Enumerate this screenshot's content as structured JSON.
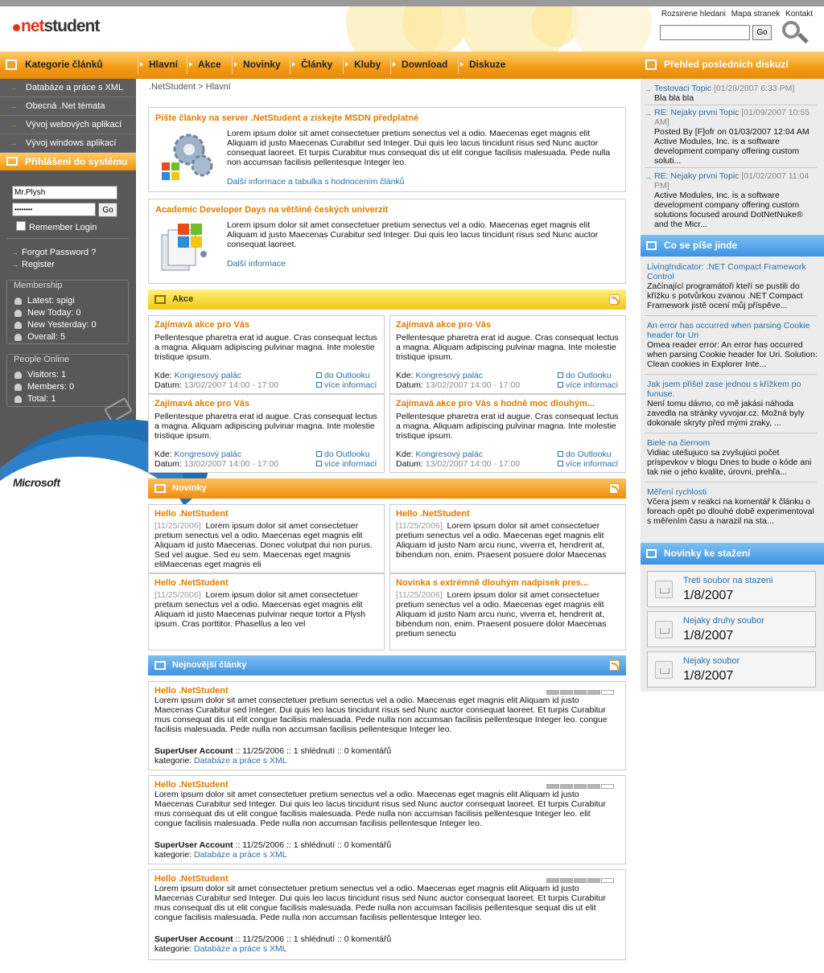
{
  "header": {
    "logo_dot": ".",
    "logo_net": "net",
    "logo_student": "student",
    "toplinks": [
      "Rozsirene hledani",
      "Mapa stranek",
      "Kontakt"
    ],
    "search_go": "Go"
  },
  "nav": {
    "categories_label": "Kategorie článků",
    "items": [
      "Hlavní",
      "Akce",
      "Novinky",
      "Články",
      "Kluby",
      "Download",
      "Diskuze"
    ],
    "right_label": "Přehled posledních diskuzí"
  },
  "sidebar": {
    "items": [
      "Databáze a práce s XML",
      "Obecná .Net témata",
      "Vývoj webových aplikací",
      "Vývoj windows aplikací"
    ],
    "login_title": "Přihlášeni do systému",
    "username": "Mr.Plysh",
    "password": "••••••••",
    "go": "Go",
    "remember": "Remember Login",
    "forgot": "Forgot Password ?",
    "register": "Register",
    "membership_title": "Membership",
    "membership": [
      "Latest: spigi",
      "New Today: 0",
      "New Yesterday: 0",
      "Overall: 5"
    ],
    "people_title": "People Online",
    "people": [
      "Visitors: 1",
      "Members: 0",
      "Total: 1"
    ],
    "microsoft": "Microsoft"
  },
  "breadcrumb": ".NetStudent > Hlavní",
  "features": [
    {
      "title": "Pište články na server .NetStudent a získejte MSDN předplatné",
      "body": "Lorem ipsum dolor sit amet consectetuer pretium senectus vel a odio. Maecenas eget magnis elit Aliquam id justo Maecenas Curabitur sed Integer. Dui quis leo lacus tincidunt risus sed Nunc auctor consequat laoreet. Et turpis Curabitur mus consequat dis ut elit congue facilisis malesuada. Pede nulla non accumsan facilisis pellentesque Integer leo.",
      "link": "Další informace a tabulka s hodnocením článků"
    },
    {
      "title": "Academic Developer Days na většině českých univerzit",
      "body": "Lorem ipsum dolor sit amet consectetuer pretium senectus vel a odio. Maecenas eget magnis elit Aliquam id justo Maecenas Curabitur sed Integer. Dui quis leo lacus tincidunt risus sed Nunc auctor consequat laoreet.",
      "link": "Další informace"
    }
  ],
  "akce": {
    "title": "Akce",
    "cards": [
      {
        "title": "Zajímavá akce pro Vás",
        "body": "Pellentesque pharetra erat id augue. Cras consequat lectus a magna. Aliquam adipiscing pulvinar magna. Inte molestie tristique ipsum.",
        "kde_label": "Kde:",
        "kde": "Kongresový palác",
        "datum_label": "Datum:",
        "datum": "13/02/2007 14:00 - 17:00",
        "outlook": "do Outlooku",
        "more": "více informací"
      },
      {
        "title": "Zajímavá akce pro Vás",
        "body": "Pellentesque pharetra erat id augue. Cras consequat lectus a magna. Aliquam adipiscing pulvinar magna. Inte molestie tristique ipsum.",
        "kde_label": "Kde:",
        "kde": "Kongresový palác",
        "datum_label": "Datum:",
        "datum": "13/02/2007 14:00 - 17:00",
        "outlook": "do Outlooku",
        "more": "více informací"
      },
      {
        "title": "Zajímavá akce pro Vás",
        "body": "Pellentesque pharetra erat id augue. Cras consequat lectus a magna. Aliquam adipiscing pulvinar magna. Inte molestie tristique ipsum.",
        "kde_label": "Kde:",
        "kde": "Kongresový palác",
        "datum_label": "Datum:",
        "datum": "13/02/2007 14:00 - 17:00",
        "outlook": "do Outlooku",
        "more": "více informací"
      },
      {
        "title": "Zajímavá akce pro Vás s hodně moc dlouhým...",
        "body": "Pellentesque pharetra erat id augue. Cras consequat lectus a magna. Aliquam adipiscing pulvinar magna. Inte molestie tristique ipsum.",
        "kde_label": "Kde:",
        "kde": "Kongresový palác",
        "datum_label": "Datum:",
        "datum": "13/02/2007 14:00 - 17:00",
        "outlook": "do Outlooku",
        "more": "více informací"
      }
    ]
  },
  "novinky": {
    "title": "Novinky",
    "cards": [
      {
        "title": "Hello .NetStudent",
        "date": "[11/25/2006]",
        "body": "Lorem ipsum dolor sit amet consectetuer pretium senectus vel a odio. Maecenas eget magnis elit Aliquam id justo Maecenas. Donec volutpat dui non purus. Sed vel augue. Sed eu sem. Maecenas eget magnis eliMaecenas eget magnis eli"
      },
      {
        "title": "Hello .NetStudent",
        "date": "[11/25/2006]",
        "body": "Lorem ipsum dolor sit amet consectetuer pretium senectus vel a odio. Maecenas eget magnis elit Aliquam id justo Nam arcu nunc, viverra et, hendrerit at, bibendum non, enim. Praesent posuere dolor Maecenas"
      },
      {
        "title": "Hello .NetStudent",
        "date": "[11/25/2006]",
        "body": "Lorem ipsum dolor sit amet consectetuer pretium senectus vel a odio. Maecenas eget magnis elit Aliquam id justo Maecenas pulvinar neque tortor a Plysh ipsum. Cras porttitor. Phasellus a leo vel"
      },
      {
        "title": "Novinka s extrémně dlouhým nadpisek pres...",
        "date": "[11/25/2006]",
        "body": "Lorem ipsum dolor sit amet consectetuer pretium senectus vel a odio. Maecenas eget magnis elit Aliquam id justo Nam arcu nunc, viverra et, hendrerit at, bibendum non, enim. Praesent posuere dolor Maecenas pretium senectu"
      }
    ]
  },
  "articles": {
    "title": "Nejnovější články",
    "items": [
      {
        "title": "Hello .NetStudent",
        "body": "Lorem ipsum dolor sit amet consectetuer pretium senectus vel a odio. Maecenas eget magnis elit Aliquam id justo Maecenas Curabitur sed Integer. Dui quis leo lacus tincidunt risus sed Nunc auctor consequat laoreet. Et turpis Curabitur mus consequat dis ut elit congue facilisis malesuada. Pede nulla non accumsan facilisis pellentesque Integer leo. congue facilisis malesuada. Pede nulla non accumsan facilisis pellentesque Integer leo.",
        "author": "SuperUser Account",
        "meta": " :: 11/25/2006 :: 1 shlédnutí :: 0 komentářů",
        "cat_label": "kategorie:",
        "category": "Databáze a práce s XML",
        "rating": 4
      },
      {
        "title": "Hello .NetStudent",
        "body": "Lorem ipsum dolor sit amet consectetuer pretium senectus vel a odio. Maecenas eget magnis elit Aliquam id justo Maecenas Curabitur sed Integer. Dui quis leo lacus tincidunt risus sed Nunc auctor consequat laoreet. Et turpis Curabitur mus consequat dis ut elit congue facilisis malesuada. Pede nulla non accumsan facilisis pellentesque Integer leo. elit congue facilisis malesuada. Pede nulla non accumsan facilisis pellentesque Integer leo.",
        "author": "SuperUser Account",
        "meta": " :: 11/25/2006 :: 1 shlédnutí :: 0 komentářů",
        "cat_label": "kategorie:",
        "category": "Databáze a práce s XML",
        "rating": 4
      },
      {
        "title": "Hello .NetStudent",
        "body": "Lorem ipsum dolor sit amet consectetuer pretium senectus vel a odio. Maecenas eget magnis elit Aliquam id justo Maecenas Curabitur sed Integer. Dui quis leo lacus tincidunt risus sed Nunc auctor consequat laoreet. Et turpis Curabitur mus consequat dis ut elit congue facilisis malesuada. Pede nulla non accumsan facilisis pellentesque sequat dis ut elit congue facilisis malesuada. Pede nulla non accumsan facilisis pellentesque Integer leo.",
        "author": "SuperUser Account",
        "meta": " :: 11/25/2006 :: 1 shlédnutí :: 0 komentářů",
        "cat_label": "kategorie:",
        "category": "Databáze a práce s XML",
        "rating": 4
      }
    ]
  },
  "discussions": [
    {
      "title": "Testovaci Topic",
      "date": "[01/28/2007 6:33 PM]",
      "text": "Bla bla bla"
    },
    {
      "title": "RE: Nejaky prvni Topic",
      "date": "[01/09/2007 10:55 AM]",
      "text": "Posted By [F]ofr on 01/03/2007 12:04 AM Active Modules, Inc. is a software development company offering custom soluti..."
    },
    {
      "title": "RE: Nejaky prvni Topic",
      "date": "[01/02/2007 11:04 PM]",
      "text": "Active Modules, Inc. is a software development company offering custom solutions focused around DotNetNuke® and the Micr..."
    }
  ],
  "elsewhere": {
    "title": "Co se píše jinde",
    "items": [
      {
        "title": "LivingIndicator: .NET Compact Framework Control",
        "text": "Začínající programátoři kteří se pustili do křížku s potvůrkou zvanou .NET Compact Framework jistě ocení můj příspěve..."
      },
      {
        "title": "An error has occurred when parsing Cookie header for Uri",
        "text": "Omea reader error: An error has occurred when parsing Cookie header for Uri. Solution: Clean cookies in Explorer Inte..."
      },
      {
        "title": "Jak jsem přišel zase jednou s křížkem po funuse.",
        "text": "Není tomu dávno, co mě jakási náhoda zavedla na stránky vyvojar.cz. Možná byly dokonale skryty před mými zraky, ..."
      },
      {
        "title": "Biele na čiernom",
        "text": "Vidiac utešujuco sa zvyšujúci počet príspevkov v blogu Dnes to bude o kóde ani tak nie o jeho kvalite, úrovni, prehľa..."
      },
      {
        "title": "Měření rychlosti",
        "text": "Včera jsem v reakci na komentář k článku o foreach opět po dlouhé době experimentoval s měřením času a narazil na sta..."
      }
    ]
  },
  "downloads": {
    "title": "Novinky ke stažení",
    "items": [
      {
        "name": "Treti soubor na stazeni",
        "date": "1/8/2007"
      },
      {
        "name": "Nejaky druhy soubor",
        "date": "1/8/2007"
      },
      {
        "name": "Nejaky soubor",
        "date": "1/8/2007"
      }
    ]
  }
}
